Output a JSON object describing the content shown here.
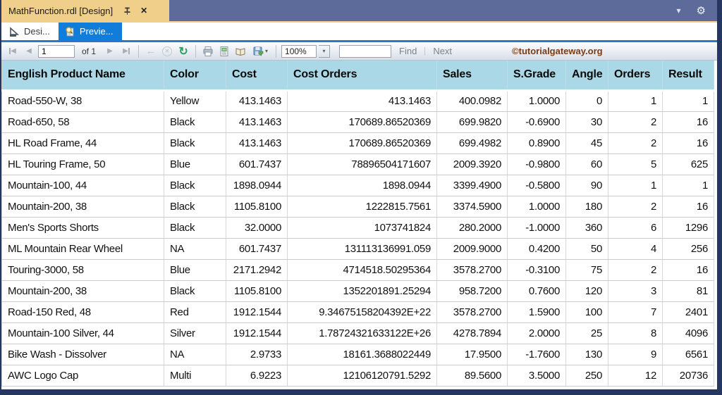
{
  "titlebar": {
    "document_tab": "MathFunction.rdl [Design]",
    "close_glyph": "✕",
    "chevron_glyph": "▾",
    "gear_glyph": "⚙"
  },
  "view_tabs": [
    {
      "label": "Desi...",
      "active": false
    },
    {
      "label": "Previe...",
      "active": true
    }
  ],
  "toolbar": {
    "page_current": "1",
    "of_label": "of  1",
    "back_glyph": "←",
    "stop_glyph": "✕",
    "refresh_glyph": "↻",
    "zoom_value": "100%",
    "dropdown_glyph": "▾",
    "find_value": "",
    "find_label": "Find",
    "next_label": "Next",
    "watermark": "©tutorialgateway.org"
  },
  "colors": {
    "accent_blue": "#0F7DD9",
    "tab_gold": "#F0CF8B",
    "frame_navy": "#253761",
    "table_header_bg": "#ABD8E6",
    "watermark_color": "#7C3A10",
    "refresh_green": "#2f9e62"
  },
  "table": {
    "columns": [
      {
        "label": "English Product Name",
        "align": "left"
      },
      {
        "label": "Color",
        "align": "left"
      },
      {
        "label": "Cost",
        "align": "right"
      },
      {
        "label": "Cost Orders",
        "align": "right"
      },
      {
        "label": "Sales",
        "align": "right"
      },
      {
        "label": "S.Grade",
        "align": "right"
      },
      {
        "label": "Angle",
        "align": "right"
      },
      {
        "label": "Orders",
        "align": "right"
      },
      {
        "label": "Result",
        "align": "right"
      }
    ],
    "rows": [
      [
        "Road-550-W, 38",
        "Yellow",
        "413.1463",
        "413.1463",
        "400.0982",
        "1.0000",
        "0",
        "1",
        "1"
      ],
      [
        "Road-650, 58",
        "Black",
        "413.1463",
        "170689.86520369",
        "699.9820",
        "-0.6900",
        "30",
        "2",
        "16"
      ],
      [
        "HL Road Frame, 44",
        "Black",
        "413.1463",
        "170689.86520369",
        "699.4982",
        "0.8900",
        "45",
        "2",
        "16"
      ],
      [
        "HL Touring Frame, 50",
        "Blue",
        "601.7437",
        "78896504171607",
        "2009.3920",
        "-0.9800",
        "60",
        "5",
        "625"
      ],
      [
        "Mountain-100, 44",
        "Black",
        "1898.0944",
        "1898.0944",
        "3399.4900",
        "-0.5800",
        "90",
        "1",
        "1"
      ],
      [
        "Mountain-200, 38",
        "Black",
        "1105.8100",
        "1222815.7561",
        "3374.5900",
        "1.0000",
        "180",
        "2",
        "16"
      ],
      [
        "Men's Sports Shorts",
        "Black",
        "32.0000",
        "1073741824",
        "280.2000",
        "-1.0000",
        "360",
        "6",
        "1296"
      ],
      [
        "ML Mountain Rear Wheel",
        "NA",
        "601.7437",
        "131113136991.059",
        "2009.9000",
        "0.4200",
        "50",
        "4",
        "256"
      ],
      [
        "Touring-3000, 58",
        "Blue",
        "2171.2942",
        "4714518.50295364",
        "3578.2700",
        "-0.3100",
        "75",
        "2",
        "16"
      ],
      [
        "Mountain-200, 38",
        "Black",
        "1105.8100",
        "1352201891.25294",
        "958.7200",
        "0.7600",
        "120",
        "3",
        "81"
      ],
      [
        "Road-150 Red, 48",
        "Red",
        "1912.1544",
        "9.34675158204392E+22",
        "3578.2700",
        "1.5900",
        "100",
        "7",
        "2401"
      ],
      [
        "Mountain-100 Silver, 44",
        "Silver",
        "1912.1544",
        "1.78724321633122E+26",
        "4278.7894",
        "2.0000",
        "25",
        "8",
        "4096"
      ],
      [
        "Bike Wash - Dissolver",
        "NA",
        "2.9733",
        "18161.3688022449",
        "17.9500",
        "-1.7600",
        "130",
        "9",
        "6561"
      ],
      [
        "AWC Logo Cap",
        "Multi",
        "6.9223",
        "12106120791.5292",
        "89.5600",
        "3.5000",
        "250",
        "12",
        "20736"
      ]
    ]
  }
}
